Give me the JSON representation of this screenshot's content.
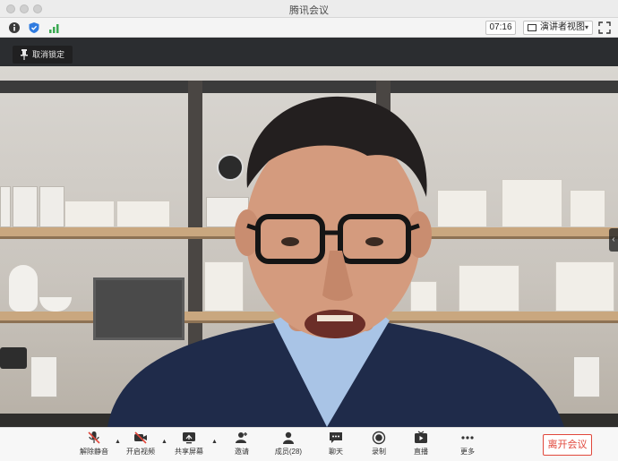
{
  "window": {
    "title": "腾讯会议"
  },
  "infobar": {
    "icons": [
      "info-icon",
      "shield-icon",
      "signal-icon"
    ],
    "timer": "07:16",
    "view_mode": {
      "label": "演讲者视图",
      "icon": "speaker-view-icon"
    },
    "fullscreen_icon": "fullscreen-icon"
  },
  "stage": {
    "unpin_label": "取消锁定",
    "side_arrow": "‹"
  },
  "toolbar": {
    "items": [
      {
        "label": "解除静音",
        "icon": "mic-muted-icon"
      },
      {
        "label": "开启视频",
        "icon": "camera-off-icon"
      },
      {
        "label": "共享屏幕",
        "icon": "share-screen-icon"
      },
      {
        "label": "邀请",
        "icon": "invite-icon"
      },
      {
        "label": "成员(28)",
        "icon": "members-icon"
      },
      {
        "label": "聊天",
        "icon": "chat-icon"
      },
      {
        "label": "录制",
        "icon": "record-icon"
      },
      {
        "label": "直播",
        "icon": "live-icon"
      },
      {
        "label": "更多",
        "icon": "more-icon"
      }
    ],
    "leave_label": "离开会议"
  },
  "colors": {
    "leave_accent": "#e1473b",
    "security_blue": "#2f7be0",
    "signal_green": "#3aa952"
  }
}
